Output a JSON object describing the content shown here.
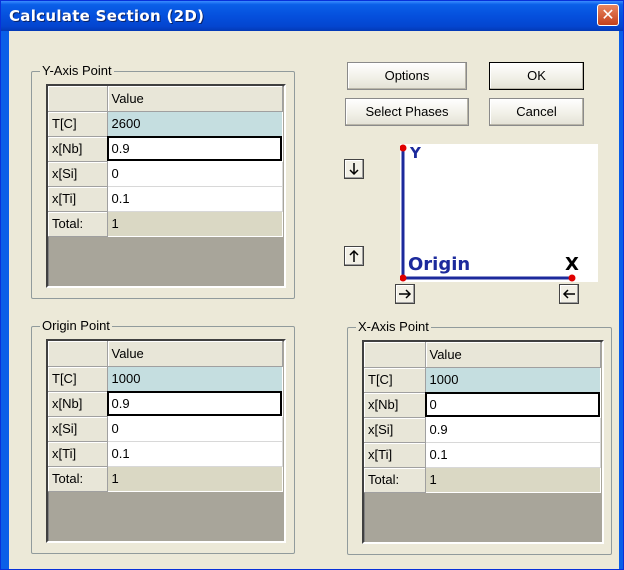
{
  "window": {
    "title": "Calculate Section (2D)",
    "close_glyph": "✕"
  },
  "buttons": {
    "options": "Options",
    "ok": "OK",
    "select_phases": "Select Phases",
    "cancel": "Cancel"
  },
  "preview": {
    "y_label": "Y",
    "x_label": "X",
    "origin_label": "Origin",
    "axis_color": "#1C2A9C",
    "point_color": "#E00000"
  },
  "table_header": "Value",
  "y_axis_point": {
    "label": "Y-Axis Point",
    "rows": [
      {
        "name": "T[C]",
        "value": "2600"
      },
      {
        "name": "x[Nb]",
        "value": "0.9"
      },
      {
        "name": "x[Si]",
        "value": "0"
      },
      {
        "name": "x[Ti]",
        "value": "0.1"
      },
      {
        "name": "Total:",
        "value": "1"
      }
    ]
  },
  "origin_point": {
    "label": "Origin Point",
    "rows": [
      {
        "name": "T[C]",
        "value": "1000"
      },
      {
        "name": "x[Nb]",
        "value": "0.9"
      },
      {
        "name": "x[Si]",
        "value": "0"
      },
      {
        "name": "x[Ti]",
        "value": "0.1"
      },
      {
        "name": "Total:",
        "value": "1"
      }
    ]
  },
  "x_axis_point": {
    "label": "X-Axis Point",
    "rows": [
      {
        "name": "T[C]",
        "value": "1000"
      },
      {
        "name": "x[Nb]",
        "value": "0"
      },
      {
        "name": "x[Si]",
        "value": "0.9"
      },
      {
        "name": "x[Ti]",
        "value": "0.1"
      },
      {
        "name": "Total:",
        "value": "1"
      }
    ]
  }
}
